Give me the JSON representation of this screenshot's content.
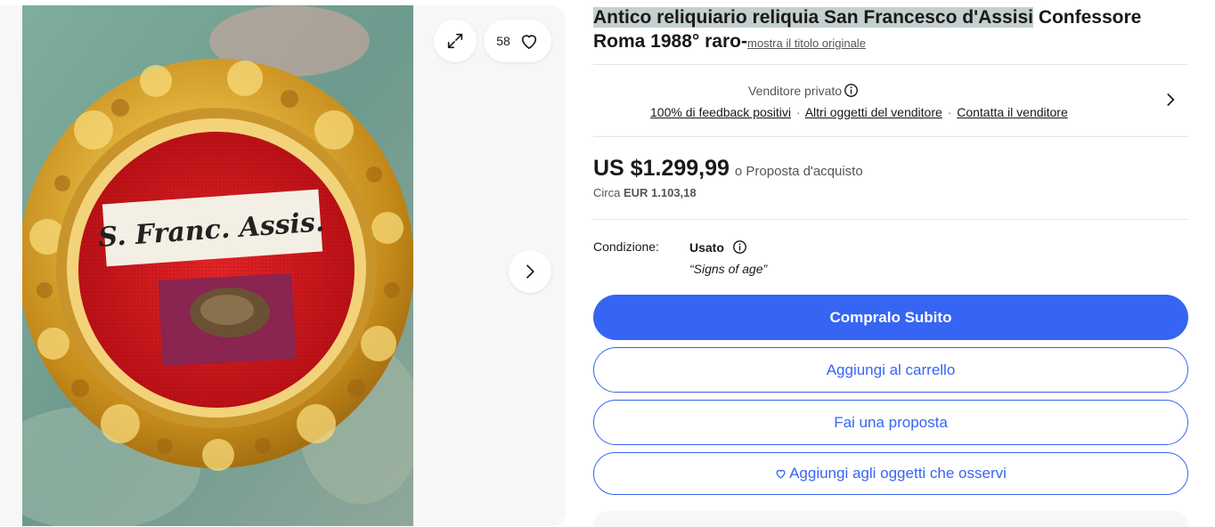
{
  "listing": {
    "title_highlight": "Antico reliquiario reliquia San Francesco d'Assisi",
    "title_rest": " Confessore Roma 1988° raro-",
    "original_title_link": "mostra il titolo originale"
  },
  "gallery": {
    "watch_count": "58",
    "relic_label": "S. Franc. Assis.",
    "icons": {
      "expand": "expand-icon",
      "heart": "heart-icon",
      "next": "chevron-right-icon"
    }
  },
  "seller": {
    "name": "Venditore privato",
    "feedback_link": "100% di feedback positivi",
    "other_items_link": "Altri oggetti del venditore",
    "contact_link": "Contatta il venditore",
    "separator": "·"
  },
  "price": {
    "amount": "US $1.299,99",
    "or_offer": "o Proposta d'acquisto",
    "approx_prefix": "Circa",
    "approx_value": "EUR 1.103,18"
  },
  "condition": {
    "label": "Condizione:",
    "value": "Usato",
    "note": "“Signs of age”"
  },
  "actions": {
    "buy_now": "Compralo Subito",
    "add_to_cart": "Aggiungi al carrello",
    "make_offer": "Fai una proposta",
    "add_to_watchlist": "Aggiungi agli oggetti che osservi"
  },
  "colors": {
    "accent": "#3665f3",
    "title_highlight": "#c4d0cf",
    "gallery_bg": "#f7f7f7"
  }
}
